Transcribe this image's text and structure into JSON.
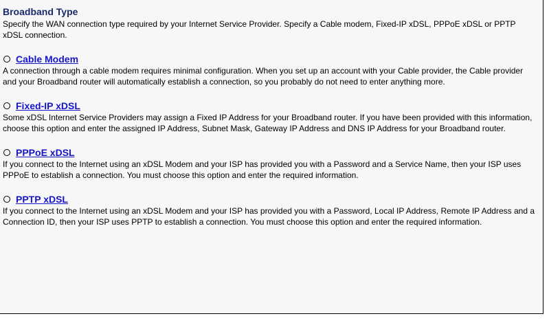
{
  "section": {
    "title": "Broadband Type",
    "description": "Specify the WAN connection type required by your Internet Service Provider. Specify a Cable modem, Fixed-IP xDSL, PPPoE xDSL or PPTP xDSL connection."
  },
  "options": [
    {
      "label": "Cable Modem",
      "description": "A connection through a cable modem requires minimal configuration. When you set up an account with your Cable provider, the Cable provider and your Broadband router will automatically establish a connection, so you probably do not need to enter anything more."
    },
    {
      "label": "Fixed-IP xDSL",
      "description": "Some xDSL Internet Service Providers may assign a Fixed IP Address for your Broadband router. If you have been provided with this information, choose this option and enter the assigned IP Address, Subnet Mask, Gateway IP Address and DNS IP Address for your Broadband router."
    },
    {
      "label": "PPPoE xDSL",
      "description": "If you connect to the Internet using an xDSL Modem and your ISP has provided you with a Password and a Service Name, then your ISP uses PPPoE to establish a connection. You must choose this option and enter the required information."
    },
    {
      "label": "PPTP xDSL",
      "description": "If you connect to the Internet using an xDSL Modem and your ISP has provided you with a Password, Local IP Address, Remote IP Address and a Connection ID, then your ISP uses PPTP to establish a connection. You must choose this option and enter the required information."
    }
  ],
  "colors": {
    "heading": "#1a2a6c",
    "link": "#1515c8",
    "panel_background": "#f7f7f7"
  }
}
